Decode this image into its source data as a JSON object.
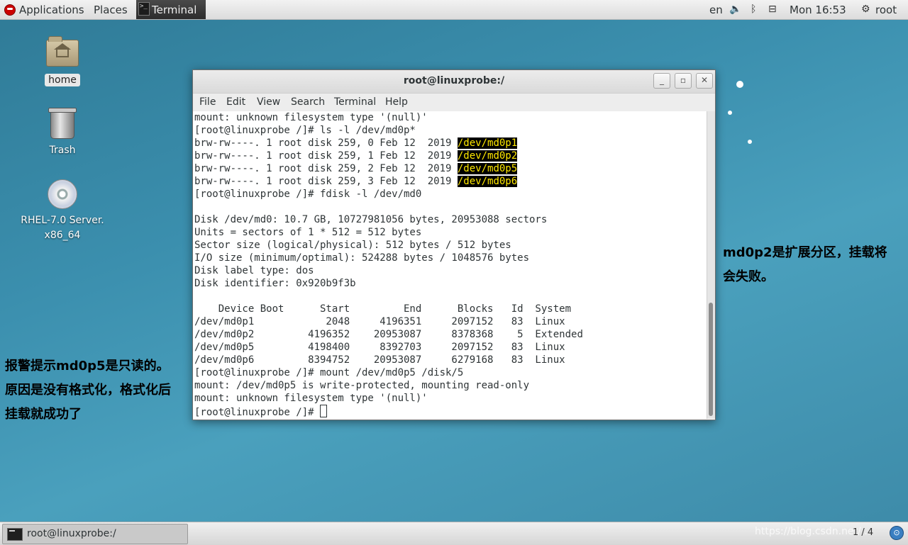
{
  "topbar": {
    "applications": "Applications",
    "places": "Places",
    "terminal": "Terminal",
    "lang": "en",
    "clock": "Mon 16:53",
    "user": "root"
  },
  "desktop": {
    "home_label": "home",
    "trash_label": "Trash",
    "dvd_label_line1": "RHEL-7.0 Server.",
    "dvd_label_line2": "x86_64"
  },
  "window": {
    "title": "root@linuxprobe:/",
    "menu": [
      "File",
      "Edit",
      "View",
      "Search",
      "Terminal",
      "Help"
    ],
    "lines": [
      {
        "text": "mount: unknown filesystem type '(null)'"
      },
      {
        "text": "[root@linuxprobe /]# ls -l /dev/md0p*"
      },
      {
        "text": "brw-rw----. 1 root disk 259, 0 Feb 12  2019 ",
        "hl": "/dev/md0p1"
      },
      {
        "text": "brw-rw----. 1 root disk 259, 1 Feb 12  2019 ",
        "hl": "/dev/md0p2"
      },
      {
        "text": "brw-rw----. 1 root disk 259, 2 Feb 12  2019 ",
        "hl": "/dev/md0p5"
      },
      {
        "text": "brw-rw----. 1 root disk 259, 3 Feb 12  2019 ",
        "hl": "/dev/md0p6"
      },
      {
        "text": "[root@linuxprobe /]# fdisk -l /dev/md0"
      },
      {
        "text": ""
      },
      {
        "text": "Disk /dev/md0: 10.7 GB, 10727981056 bytes, 20953088 sectors"
      },
      {
        "text": "Units = sectors of 1 * 512 = 512 bytes"
      },
      {
        "text": "Sector size (logical/physical): 512 bytes / 512 bytes"
      },
      {
        "text": "I/O size (minimum/optimal): 524288 bytes / 1048576 bytes"
      },
      {
        "text": "Disk label type: dos"
      },
      {
        "text": "Disk identifier: 0x920b9f3b"
      },
      {
        "text": ""
      },
      {
        "text": "    Device Boot      Start         End      Blocks   Id  System"
      },
      {
        "text": "/dev/md0p1            2048     4196351     2097152   83  Linux"
      },
      {
        "text": "/dev/md0p2         4196352    20953087     8378368    5  Extended"
      },
      {
        "text": "/dev/md0p5         4198400     8392703     2097152   83  Linux"
      },
      {
        "text": "/dev/md0p6         8394752    20953087     6279168   83  Linux"
      },
      {
        "text": "[root@linuxprobe /]# mount /dev/md0p5 /disk/5"
      },
      {
        "text": "mount: /dev/md0p5 is write-protected, mounting read-only"
      },
      {
        "text": "mount: unknown filesystem type '(null)'"
      },
      {
        "text": "[root@linuxprobe /]# ",
        "cursor": true
      }
    ]
  },
  "notes": {
    "right_line1": "md0p2是扩展分区，挂载将",
    "right_line2": "会失败。",
    "left_line1": "报警提示md0p5是只读的。",
    "left_line2": "原因是没有格式化，格式化后",
    "left_line3": "挂载就成功了"
  },
  "bottombar": {
    "task_label": "root@linuxprobe:/",
    "watermark": "https://blog.csdn.net/...",
    "pager": "1 / 4"
  }
}
